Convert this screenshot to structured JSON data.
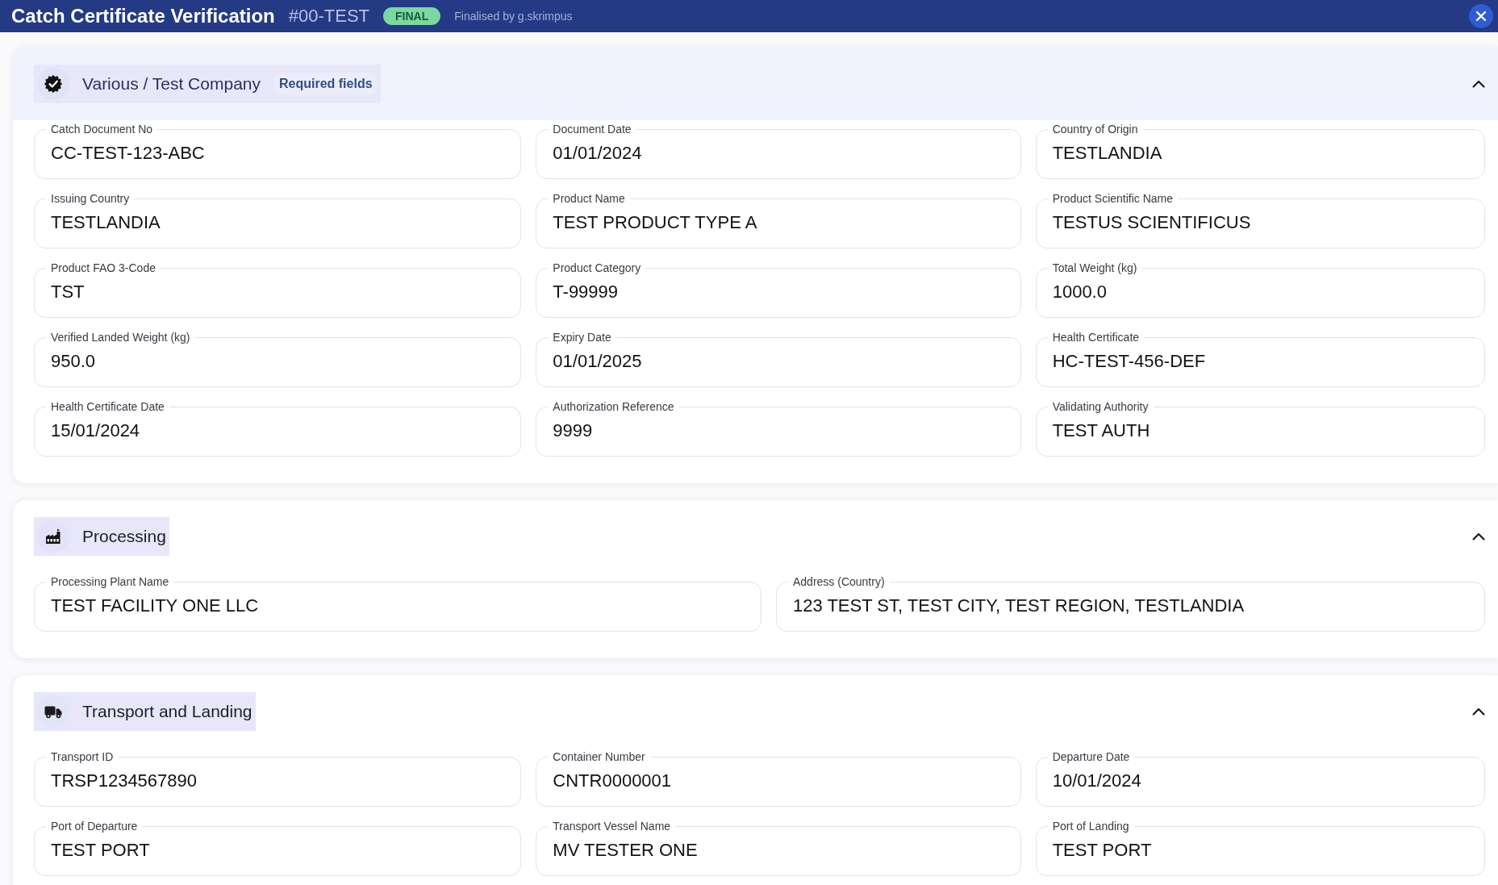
{
  "header": {
    "title": "Catch Certificate Verification",
    "reference": "#00-TEST",
    "status": "FINAL",
    "finalised_by": "Finalised by g.skrimpus"
  },
  "sections": [
    {
      "kind": "company",
      "title": "Various / Test Company",
      "badge": "Required fields",
      "highlighted": true,
      "expanded": true,
      "fields": [
        {
          "label": "Catch Document No",
          "value": "CC-TEST-123-ABC"
        },
        {
          "label": "Document Date",
          "value": "01/01/2024"
        },
        {
          "label": "Country of Origin",
          "value": "TESTLANDIA"
        },
        {
          "label": "Issuing Country",
          "value": "TESTLANDIA"
        },
        {
          "label": "Product Name",
          "value": "TEST PRODUCT TYPE A"
        },
        {
          "label": "Product Scientific Name",
          "value": "TESTUS SCIENTIFICUS"
        },
        {
          "label": "Product FAO 3-Code",
          "value": "TST"
        },
        {
          "label": "Product Category",
          "value": "T-99999"
        },
        {
          "label": "Total Weight (kg)",
          "value": "1000.0"
        },
        {
          "label": "Verified Landed Weight (kg)",
          "value": "950.0"
        },
        {
          "label": "Expiry Date",
          "value": "01/01/2025"
        },
        {
          "label": "Health Certificate",
          "value": "HC-TEST-456-DEF"
        },
        {
          "label": "Health Certificate Date",
          "value": "15/01/2024"
        },
        {
          "label": "Authorization Reference",
          "value": "9999"
        },
        {
          "label": "Validating Authority",
          "value": "TEST AUTH"
        }
      ]
    },
    {
      "kind": "processing",
      "title": "Processing",
      "highlighted": false,
      "expanded": true,
      "fields": [
        {
          "label": "Processing Plant Name",
          "value": "TEST FACILITY ONE LLC"
        },
        {
          "label": "Address (Country)",
          "value": "123 TEST ST, TEST CITY, TEST REGION, TESTLANDIA"
        }
      ]
    },
    {
      "kind": "transport",
      "title": "Transport and Landing",
      "highlighted": false,
      "expanded": true,
      "fields": [
        {
          "label": "Transport ID",
          "value": "TRSP1234567890"
        },
        {
          "label": "Container Number",
          "value": "CNTR0000001"
        },
        {
          "label": "Departure Date",
          "value": "10/01/2024"
        },
        {
          "label": "Port of Departure",
          "value": "TEST PORT"
        },
        {
          "label": "Transport Vessel Name",
          "value": "MV TESTER ONE"
        },
        {
          "label": "Port of Landing",
          "value": "TEST PORT"
        }
      ]
    }
  ]
}
